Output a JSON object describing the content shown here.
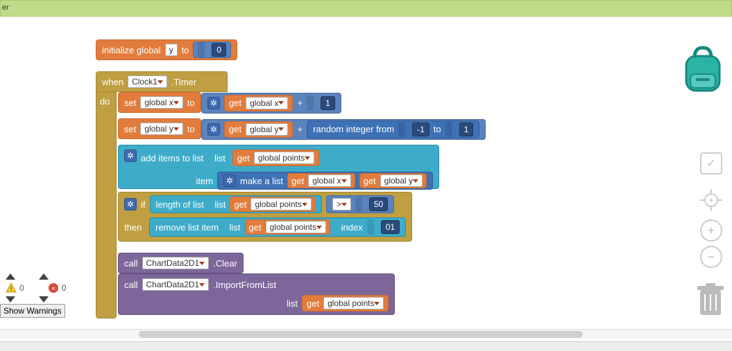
{
  "topbar": {
    "text": "er"
  },
  "init": {
    "label": "initialize global",
    "var": "y",
    "to": "to",
    "value": "0"
  },
  "event": {
    "when": "when",
    "component": "Clock1",
    "suffix": ".Timer",
    "do": "do"
  },
  "setx": {
    "set": "set",
    "var": "global x",
    "to": "to",
    "get": "get",
    "getvar": "global x",
    "plus": "+",
    "value": "1"
  },
  "sety": {
    "set": "set",
    "var": "global y",
    "to": "to",
    "get": "get",
    "getvar": "global y",
    "plus": "+",
    "rand": "random integer from",
    "from": "-1",
    "toLbl": "to",
    "toVal": "1"
  },
  "additems": {
    "label": "add items to list",
    "list": "list",
    "get": "get",
    "getvar": "global points",
    "item": "item",
    "make": "make a list",
    "gx": "global x",
    "gy": "global y"
  },
  "ifblk": {
    "if": "if",
    "len": "length of list",
    "list": "list",
    "get": "get",
    "getvar": "global points",
    "op": ">",
    "val": "50",
    "then": "then",
    "remove": "remove list item",
    "index": "index",
    "idx": "01"
  },
  "call1": {
    "call": "call",
    "comp": "ChartData2D1",
    "method": ".Clear"
  },
  "call2": {
    "call": "call",
    "comp": "ChartData2D1",
    "method": ".ImportFromList",
    "arg": "list",
    "get": "get",
    "getvar": "global points"
  },
  "warnings": {
    "c1": "0",
    "c2": "0",
    "btn": "Show Warnings"
  }
}
